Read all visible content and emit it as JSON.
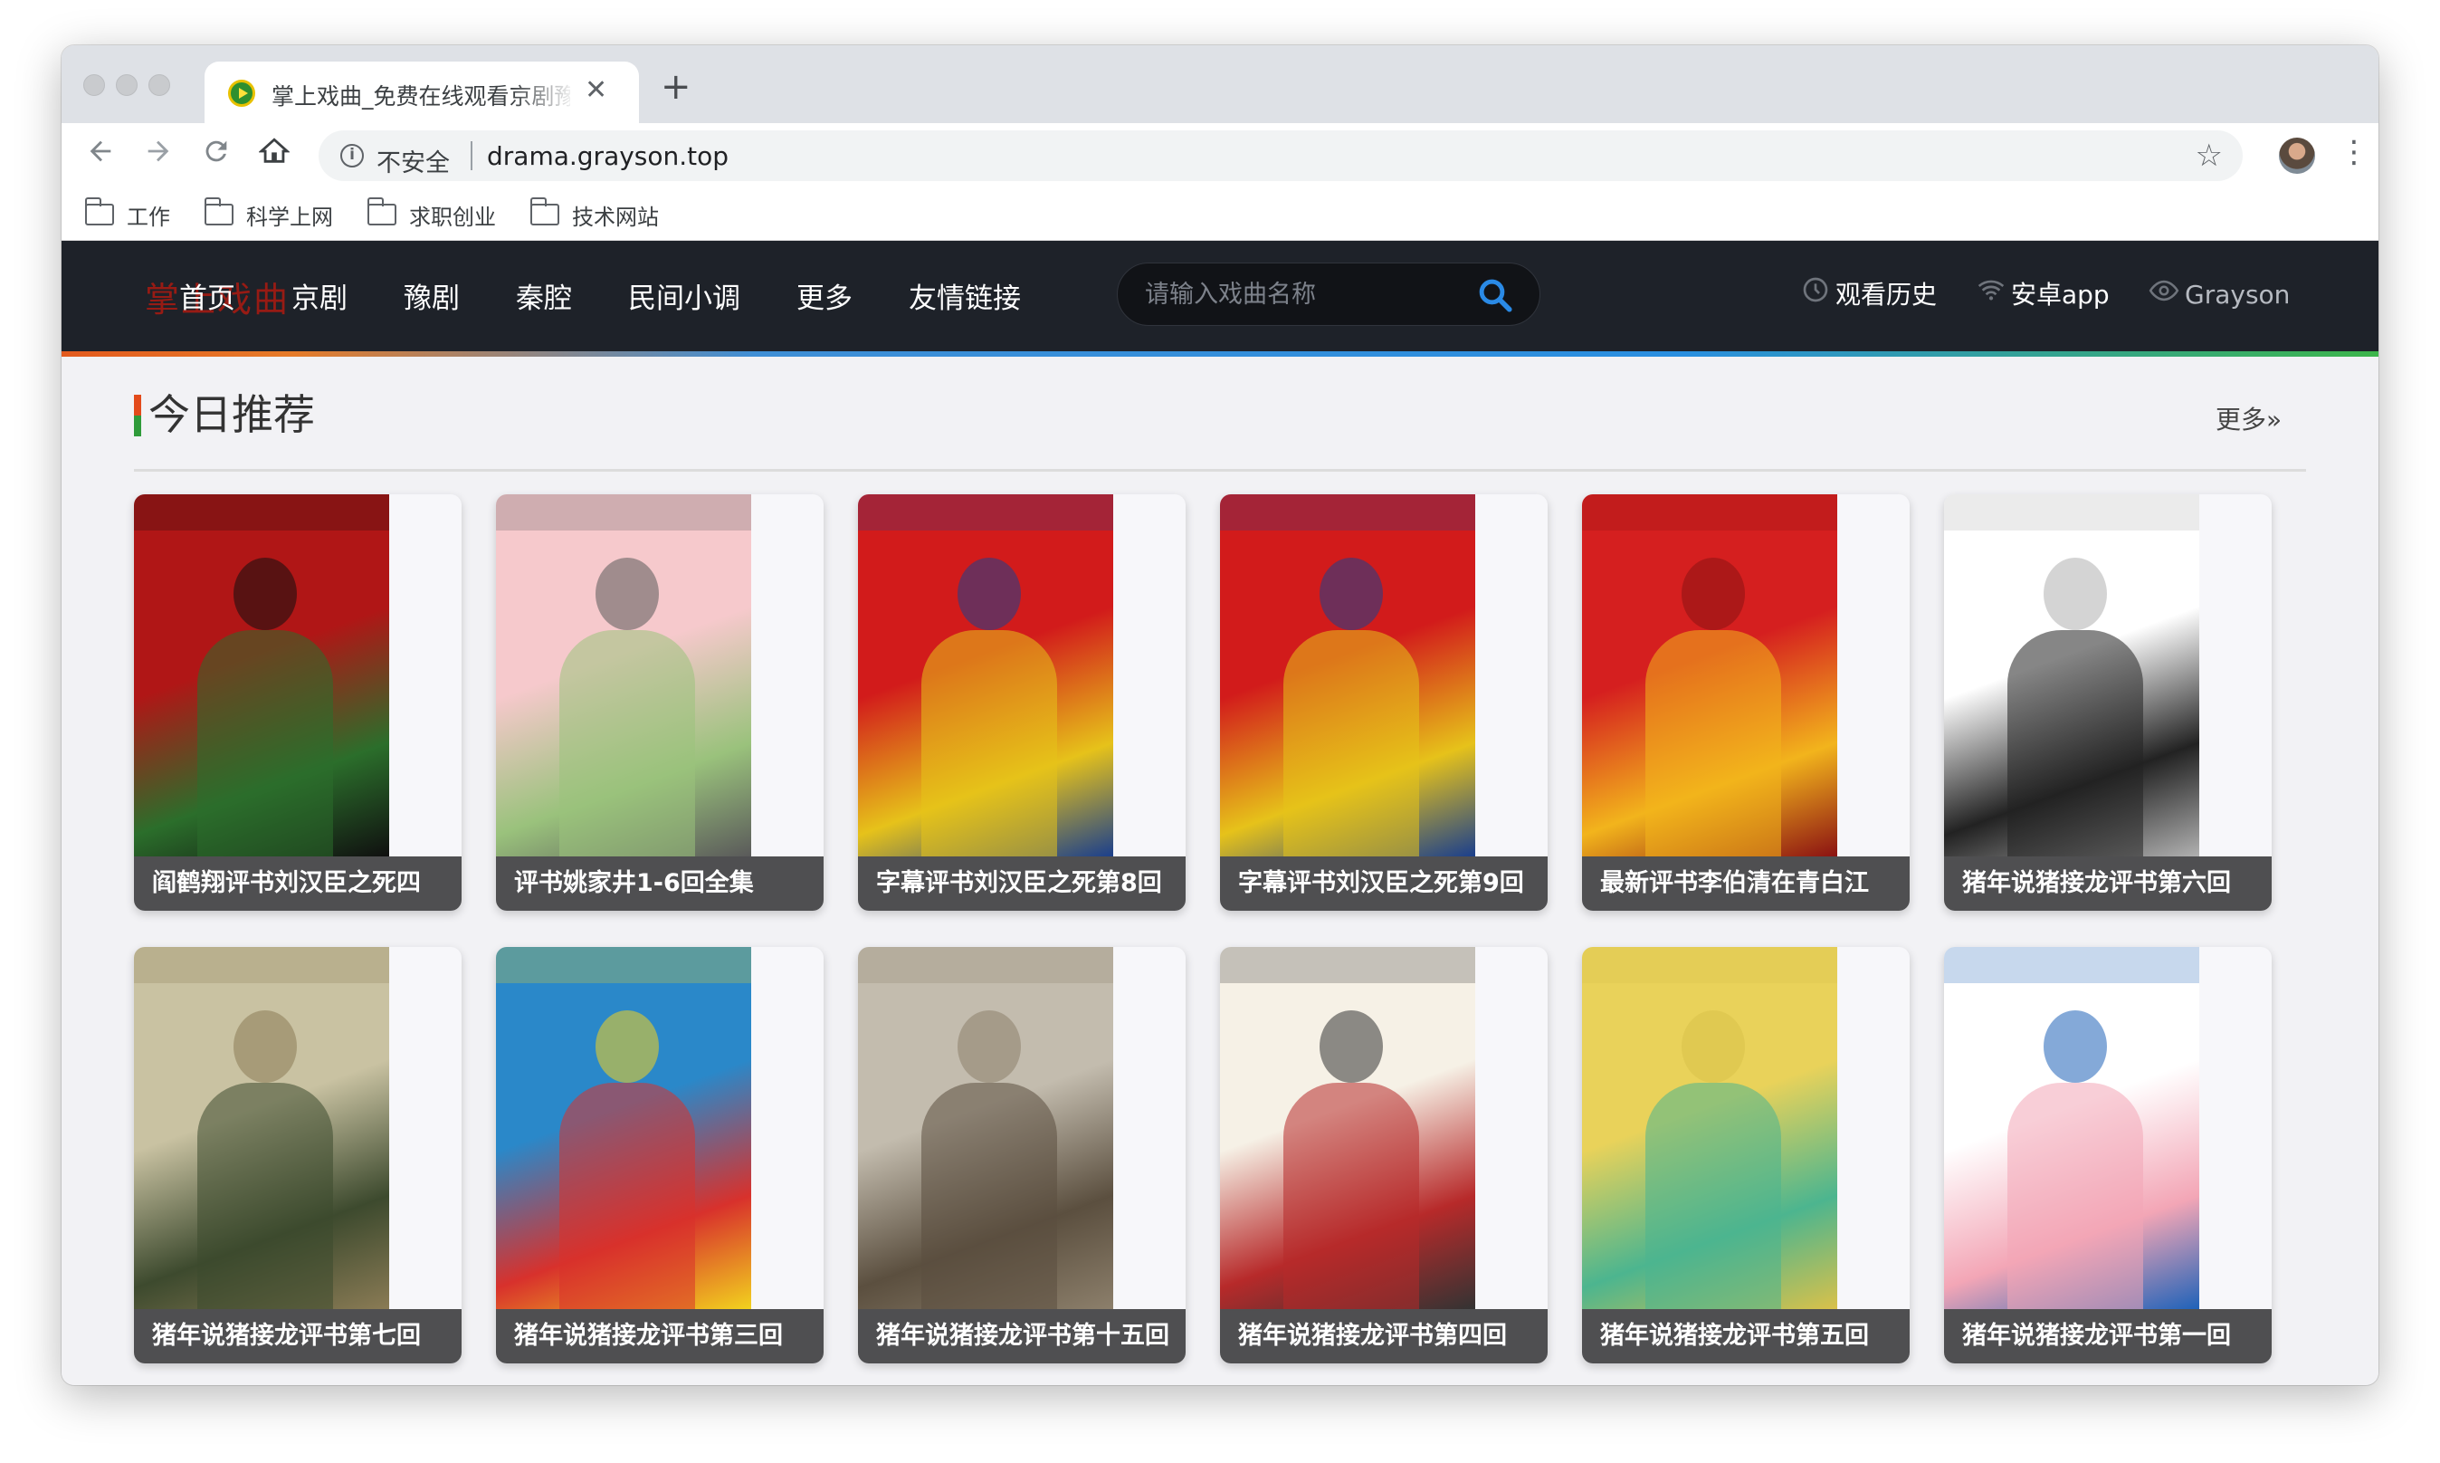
{
  "browser": {
    "tab_title": "掌上戏曲_免费在线观看京剧豫剧",
    "tab_close": "✕",
    "new_tab": "+",
    "security_label": "不安全",
    "url": "drama.grayson.top",
    "bookmarks": [
      "工作",
      "科学上网",
      "求职创业",
      "技术网站"
    ]
  },
  "site": {
    "logo_text": "掌上戏曲",
    "nav": [
      "首页",
      "京剧",
      "豫剧",
      "秦腔",
      "民间小调",
      "更多",
      "友情链接"
    ],
    "search_placeholder": "请输入戏曲名称",
    "history": "观看历史",
    "android": "安卓app",
    "user": "Grayson"
  },
  "section": {
    "title": "今日推荐",
    "more": "更多»"
  },
  "cards": [
    {
      "title": "阎鹤翔评书刘汉臣之死四",
      "palette": [
        "#b01616",
        "#2b6e2b",
        "#101010"
      ]
    },
    {
      "title": "评书姚家井1-6回全集",
      "palette": [
        "#f6c9cc",
        "#9ac27c",
        "#5a5a5a"
      ]
    },
    {
      "title": "字幕评书刘汉臣之死第8回",
      "palette": [
        "#d21b1b",
        "#e6c21a",
        "#1b3f8c"
      ]
    },
    {
      "title": "字幕评书刘汉臣之死第9回",
      "palette": [
        "#d21b1b",
        "#e6c21a",
        "#1b3f8c"
      ]
    },
    {
      "title": "最新评书李伯清在青白江",
      "palette": [
        "#d51f1f",
        "#f2b41c",
        "#8b1212"
      ]
    },
    {
      "title": "猪年说猪接龙评书第六回",
      "palette": [
        "#ffffff",
        "#222222",
        "#b0b0b0"
      ]
    },
    {
      "title": "猪年说猪接龙评书第七回",
      "palette": [
        "#c9c2a2",
        "#3d4a2e",
        "#8a7b55"
      ]
    },
    {
      "title": "猪年说猪接龙评书第三回",
      "palette": [
        "#2a88c9",
        "#d8312c",
        "#f2d21e"
      ]
    },
    {
      "title": "猪年说猪接龙评书第十五回",
      "palette": [
        "#c3bcae",
        "#5b4f3f",
        "#8c7f6b"
      ]
    },
    {
      "title": "猪年说猪接龙评书第四回",
      "palette": [
        "#f6f1e6",
        "#b72a2a",
        "#333333"
      ]
    },
    {
      "title": "猪年说猪接龙评书第五回",
      "palette": [
        "#e9d25a",
        "#4cb58f",
        "#d9c14a"
      ]
    },
    {
      "title": "猪年说猪接龙评书第一回",
      "palette": [
        "#ffffff",
        "#f3a6b6",
        "#1f62b8"
      ]
    }
  ]
}
